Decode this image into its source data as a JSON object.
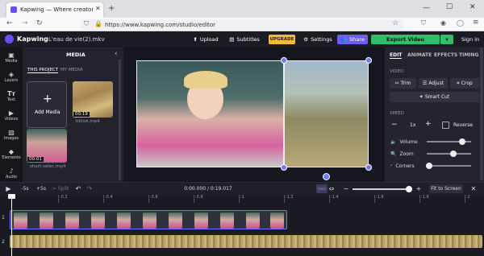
{
  "browser": {
    "tab_title": "Kapwing — Where creators bel",
    "url": "https://www.kapwing.com/studio/editor"
  },
  "header": {
    "brand": "Kapwing",
    "project_title": "L'eau de vie(2).mkv",
    "upload": "Upload",
    "subtitles": "Subtitles",
    "upgrade": "UPGRADE",
    "settings": "Settings",
    "share": "Share",
    "export": "Export Video",
    "signin": "Sign in"
  },
  "nav": [
    "Media",
    "Layers",
    "Text",
    "Videos",
    "Images",
    "Elements",
    "Audio"
  ],
  "media": {
    "title": "MEDIA",
    "tab_project": "THIS PROJECT",
    "tab_mine": "MY MEDIA",
    "add": "Add Media",
    "items": [
      {
        "duration": "00:19",
        "name": "tiktok.mp4"
      },
      {
        "duration": "00:01",
        "name": "short-selec.mp4"
      }
    ]
  },
  "right": {
    "tabs": [
      "EDIT",
      "ANIMATE",
      "EFFECTS",
      "TIMING"
    ],
    "video_label": "VIDEO",
    "trim": "Trim",
    "adjust": "Adjust",
    "crop": "Crop",
    "smart_cut": "Smart Cut",
    "speed_label": "SPEED",
    "speed_value": "1x",
    "reverse": "Reverse",
    "volume": "Volume",
    "zoom": "Zoom",
    "corners": "Corners",
    "volume_level": 0.8,
    "zoom_level": 0.6,
    "corners_level": 0.05
  },
  "timeline": {
    "back": "-5s",
    "fwd": "+5s",
    "split": "Split",
    "time": "0:00.000 / 0:19.017",
    "fit": "Fit to Screen",
    "ticks": [
      "0",
      ":0.2",
      ":0.4",
      ":0.6",
      ":0.8",
      ":1",
      ":1.2",
      ":1.4",
      ":1.6",
      ":1.8",
      ":2"
    ],
    "tracks": [
      "1",
      "2"
    ]
  }
}
